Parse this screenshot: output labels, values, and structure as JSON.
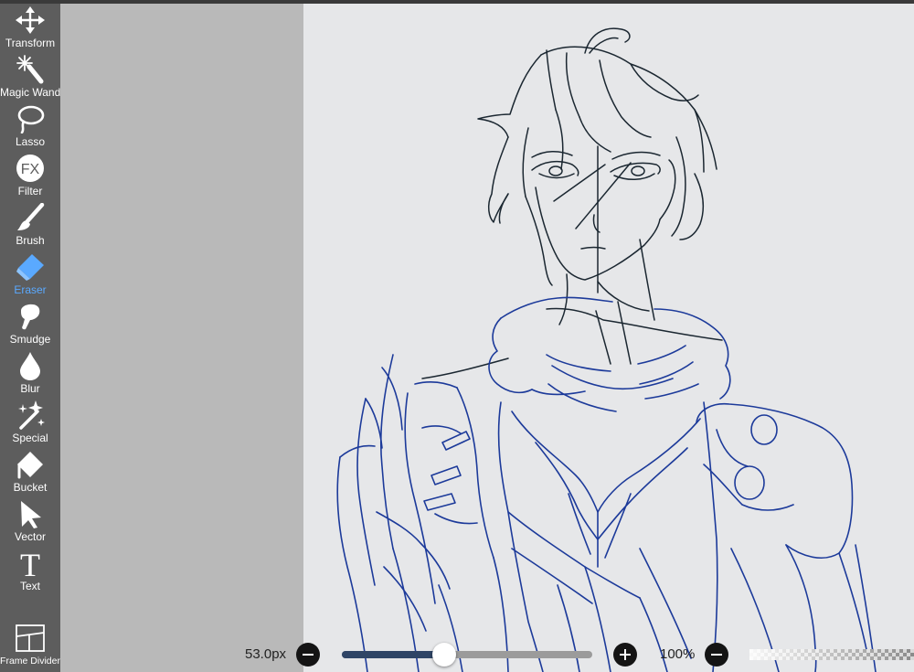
{
  "tools": [
    {
      "id": "transform",
      "label": "Transform",
      "icon": "move-arrows-icon",
      "active": false
    },
    {
      "id": "magic-wand",
      "label": "Magic Wand",
      "icon": "magic-wand-icon",
      "active": false
    },
    {
      "id": "lasso",
      "label": "Lasso",
      "icon": "lasso-icon",
      "active": false
    },
    {
      "id": "filter",
      "label": "Filter",
      "icon": "fx-icon",
      "active": false
    },
    {
      "id": "brush",
      "label": "Brush",
      "icon": "brush-icon",
      "active": false
    },
    {
      "id": "eraser",
      "label": "Eraser",
      "icon": "eraser-icon",
      "active": true
    },
    {
      "id": "smudge",
      "label": "Smudge",
      "icon": "smudge-icon",
      "active": false
    },
    {
      "id": "blur",
      "label": "Blur",
      "icon": "blur-drop-icon",
      "active": false
    },
    {
      "id": "special",
      "label": "Special",
      "icon": "sparkle-icon",
      "active": false
    },
    {
      "id": "bucket",
      "label": "Bucket",
      "icon": "bucket-icon",
      "active": false
    },
    {
      "id": "vector",
      "label": "Vector",
      "icon": "cursor-arrow-icon",
      "active": false
    },
    {
      "id": "text",
      "label": "Text",
      "icon": "text-icon",
      "active": false
    },
    {
      "id": "frame-divider",
      "label": "Frame Divider",
      "icon": "frame-divider-icon",
      "active": false
    }
  ],
  "filter_icon_text": "FX",
  "text_icon_glyph": "T",
  "bottom_bar": {
    "brush_size": "53.0px",
    "brush_size_fraction": 0.41,
    "opacity": "100%"
  },
  "colors": {
    "sidebar": "#5d5d5d",
    "active_tool": "#5aa9ff",
    "canvas": "#e6e7e9",
    "sketch_dark": "#1b2731",
    "sketch_blue": "#1c3a9a",
    "slider_fill": "#2f4566"
  }
}
